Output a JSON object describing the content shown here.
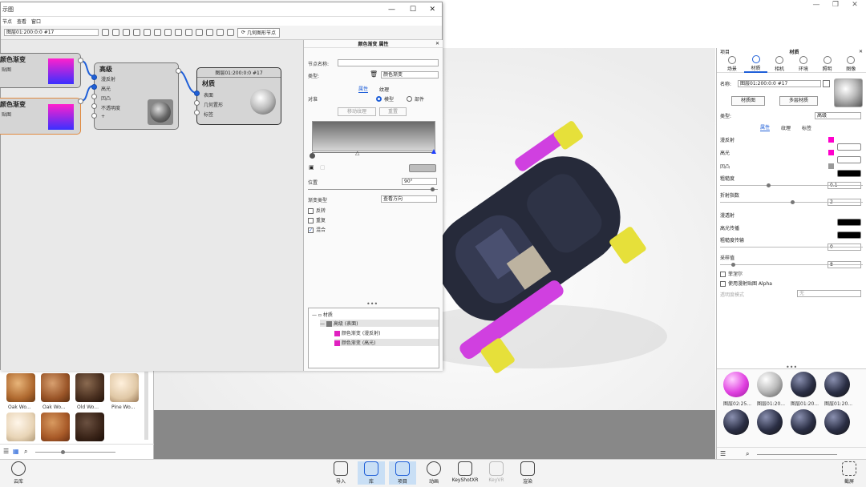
{
  "app": {
    "window_controls": [
      "—",
      "❐",
      "✕"
    ]
  },
  "dialog": {
    "title": "示图",
    "controls": [
      "—",
      "☐",
      "✕"
    ],
    "menu": [
      "节点",
      "查看",
      "窗口"
    ],
    "material_combo": "图层01:200:0:0 #17",
    "geometry_button": "几何图形节点"
  },
  "nodes": {
    "grad1": {
      "title": "颜色渐变",
      "port": "贴图"
    },
    "grad2": {
      "title": "颜色渐变",
      "port": "贴图"
    },
    "advanced": {
      "title": "高级",
      "ports": [
        "漫反射",
        "高光",
        "凹凸",
        "不透明度",
        "+"
      ]
    },
    "material": {
      "header": "图层01:200:0:0 #17",
      "title": "材质",
      "ports": [
        "表面",
        "几何置形",
        "标签"
      ]
    }
  },
  "props": {
    "panel_title": "颜色渐变 属性",
    "node_name_label": "节点名称:",
    "type_label": "类型:",
    "type_value": "颜色渐变",
    "tabs": [
      "属性",
      "纹理"
    ],
    "align_label": "对准",
    "align_options": [
      "模型",
      "部件"
    ],
    "move_texture_btn": "移动纹理",
    "reset_btn": "重置",
    "position_label": "位置",
    "position_value": "90°",
    "gradient_type_label": "渐变类型",
    "gradient_type_value": "查看方向",
    "checkboxes": [
      {
        "label": "反转",
        "checked": false
      },
      {
        "label": "重复",
        "checked": false
      },
      {
        "label": "混合",
        "checked": true
      }
    ],
    "tree": {
      "root": "材质",
      "child": "高级 (表面)",
      "leaf1": "颜色渐变 (漫反射)",
      "leaf2": "颜色渐变 (高光)"
    },
    "gradient_colors": {
      "start": "#9a9a9a",
      "end": "#e8e8e8"
    }
  },
  "right": {
    "top_labels": [
      "项目",
      "材质"
    ],
    "tabs": [
      "场景",
      "材质",
      "相机",
      "环境",
      "照明",
      "图像"
    ],
    "name_label": "名称:",
    "name_value": "图层01:200:0:0 #17",
    "graph_btn": "材质图",
    "multi_btn": "多层材质",
    "type_label": "类型:",
    "type_value": "高级",
    "subtabs": [
      "属性",
      "纹理",
      "标签"
    ],
    "props": [
      {
        "label": "漫反射",
        "color": "#ff00cc"
      },
      {
        "label": "高光",
        "color": "#ff00cc"
      },
      {
        "label": "凹凸",
        "color": "#000000"
      },
      {
        "label": "粗糙度",
        "value": "0.1"
      },
      {
        "label": "折射指数",
        "value": "2"
      },
      {
        "label": "漫透射",
        "color": "#000000"
      },
      {
        "label": "高光传播",
        "color": "#000000"
      },
      {
        "label": "粗糙度传输",
        "value": "0"
      },
      {
        "label": "采样值",
        "value": "8"
      }
    ],
    "checkboxes": [
      "菲涅尔",
      "使用漫射贴图 Alpha"
    ],
    "transparency_label": "透明度模式",
    "transparency_value": "无",
    "materials": [
      "图层02:25...",
      "图层01:20...",
      "图层01:20...",
      "图层01:20..."
    ]
  },
  "library": {
    "items": [
      "Oak Wo...",
      "Oak Wo...",
      "Old Wo...",
      "Pine Wo..."
    ]
  },
  "bottom": {
    "left": "云库",
    "items": [
      "导入",
      "库",
      "项目",
      "动画",
      "KeyShotXR",
      "KeyVR",
      "渲染"
    ],
    "right": "截屏"
  }
}
